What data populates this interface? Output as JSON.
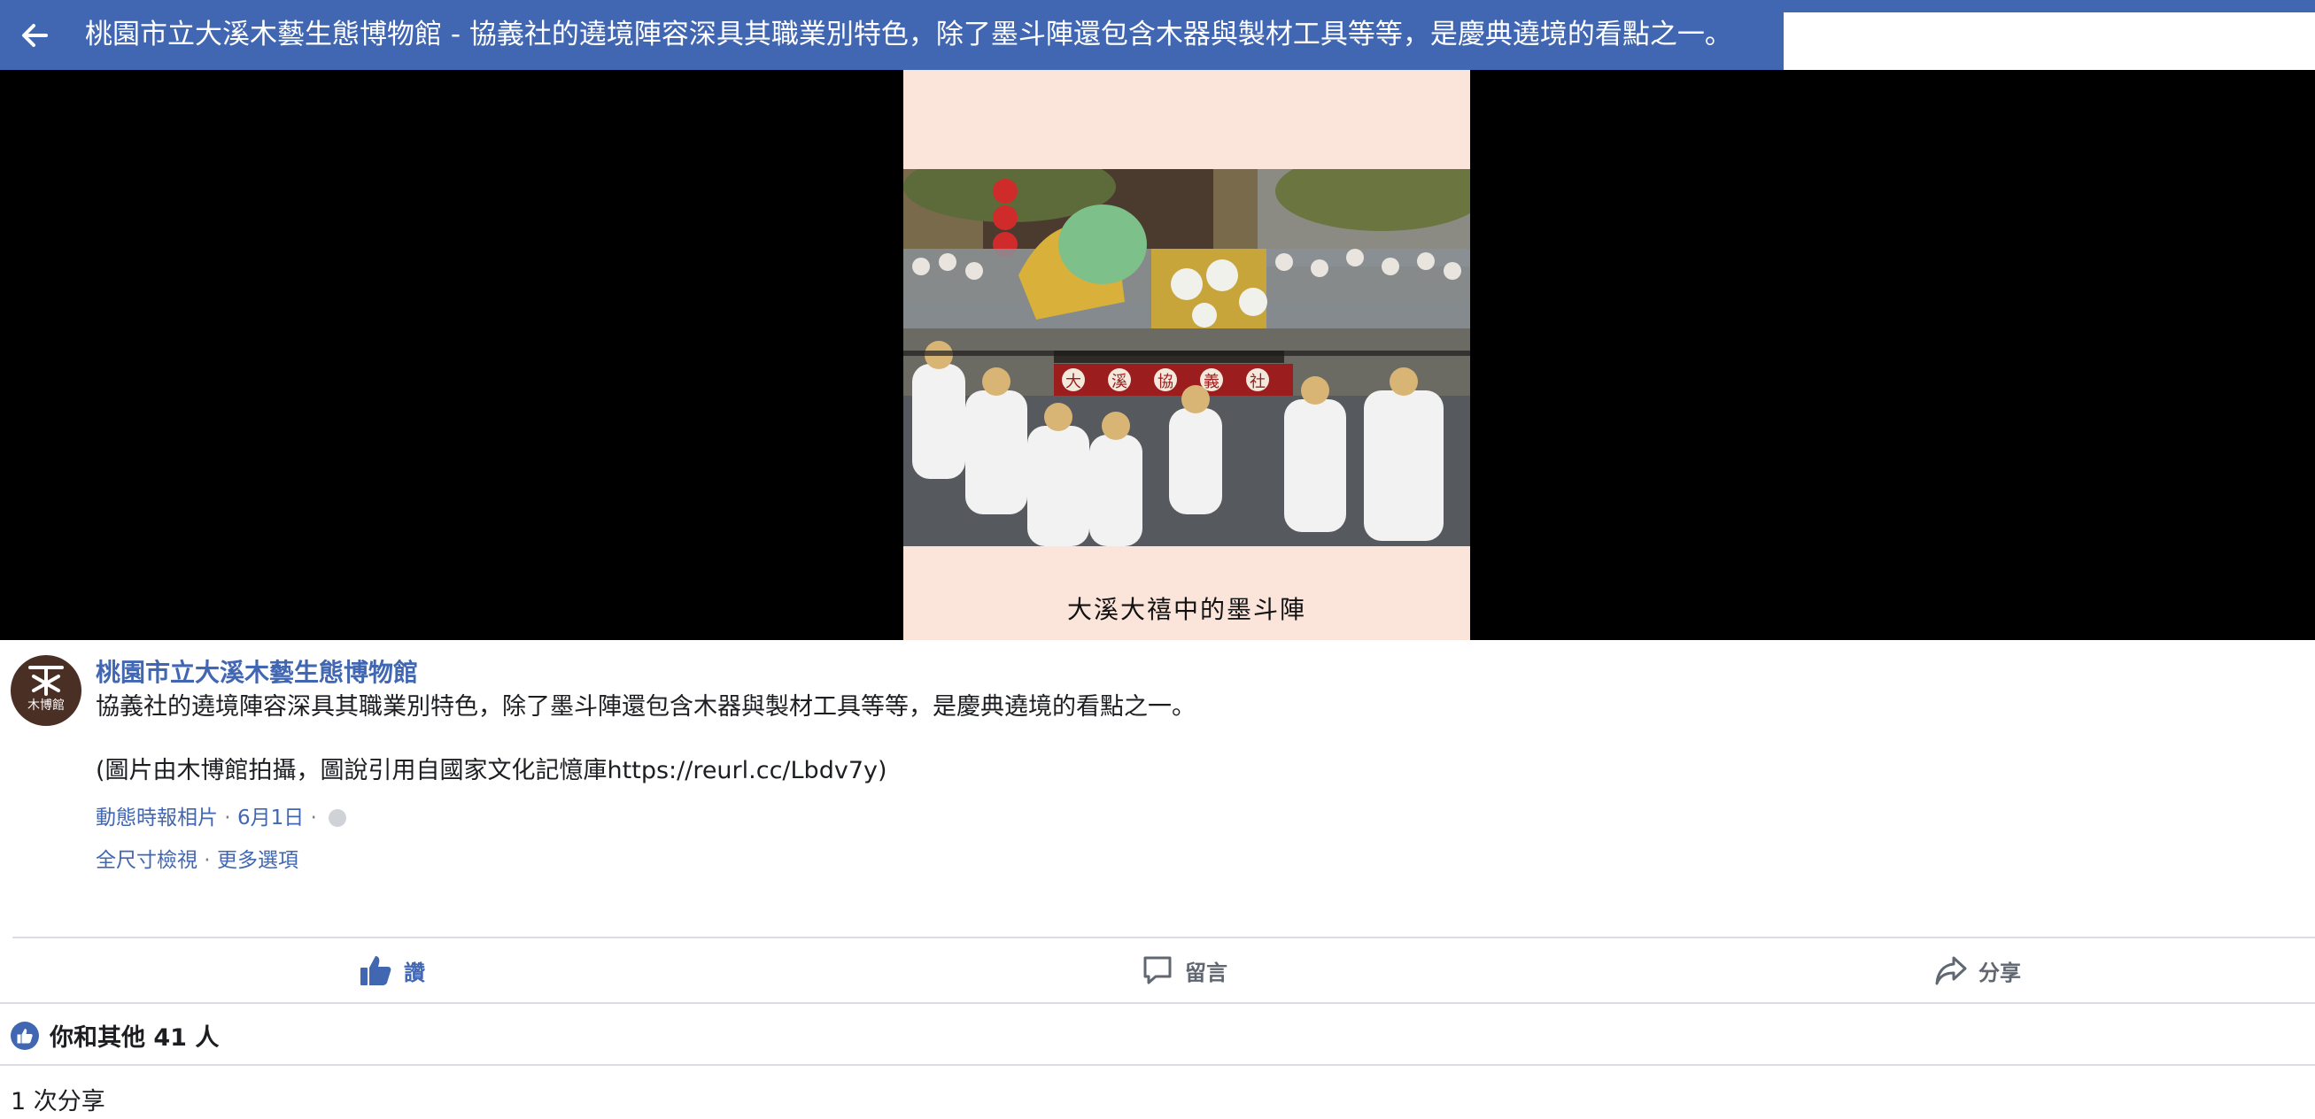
{
  "header": {
    "title": "桃園市立大溪木藝生態博物館 - 協義社的遶境陣容深具其職業別特色，除了墨斗陣還包含木器與製材工具等等，是慶典遶境的看點之一。"
  },
  "loader": {
    "colors": [
      "#4caf50",
      "#f4b400",
      "#ff8a00",
      "#4285f4"
    ]
  },
  "media": {
    "image_caption": "大溪大禧中的墨斗陣",
    "banner_chars": [
      "大",
      "溪",
      "協",
      "義",
      "社"
    ]
  },
  "post": {
    "page_name": "桃園市立大溪木藝生態博物館",
    "avatar_text": "木博館",
    "text_line1": "協義社的遶境陣容深具其職業別特色，除了墨斗陣還包含木器與製材工具等等，是慶典遶境的看點之一。",
    "text_line2": "(圖片由木博館拍攝，圖說引用自國家文化記憶庫https://reurl.cc/Lbdv7y)",
    "meta_album": "動態時報相片",
    "meta_date": "6月1日",
    "meta_sep": " · ",
    "option_full": "全尺寸檢視",
    "option_more": "更多選項"
  },
  "actions": {
    "like": "讚",
    "comment": "留言",
    "share": "分享"
  },
  "reactions": {
    "likes_text": "你和其他 41 人",
    "shares_text": "1 次分享"
  },
  "colors": {
    "brand": "#4267b2",
    "card_bg": "#fbe4d9"
  }
}
